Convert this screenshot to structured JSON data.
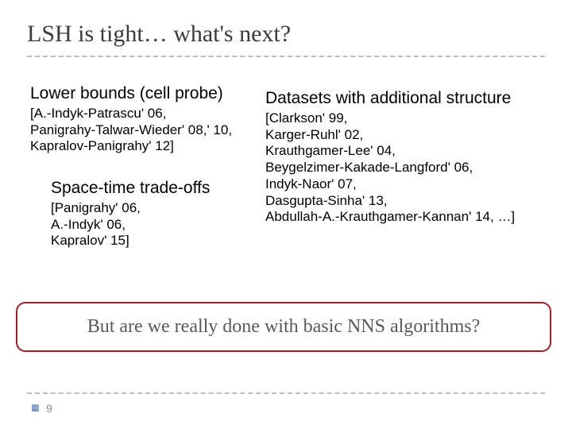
{
  "title": "LSH is tight… what's next?",
  "lowerBounds": {
    "heading": "Lower bounds (cell probe)",
    "refs": "[A.-Indyk-Patrascu' 06,\nPanigrahy-Talwar-Wieder' 08,' 10,\nKapralov-Panigrahy' 12]"
  },
  "spaceTime": {
    "heading": "Space-time trade-offs",
    "refs": "[Panigrahy' 06,\nA.-Indyk' 06,\nKapralov' 15]"
  },
  "datasets": {
    "heading": "Datasets with additional structure",
    "refs": "[Clarkson' 99,\nKarger-Ruhl' 02,\nKrauthgamer-Lee' 04,\nBeygelzimer-Kakade-Langford' 06,\nIndyk-Naor' 07,\nDasgupta-Sinha' 13,\nAbdullah-A.-Krauthgamer-Kannan' 14, …]"
  },
  "callout": "But are we really done with basic NNS algorithms?",
  "pageNumber": "9"
}
